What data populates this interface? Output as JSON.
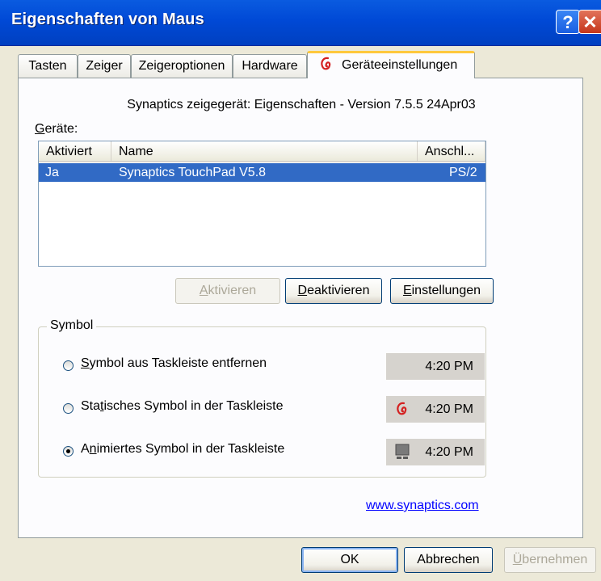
{
  "window": {
    "title": "Eigenschaften von Maus",
    "help_glyph": "?",
    "close_glyph": "✕"
  },
  "tabs": [
    {
      "label": "Tasten"
    },
    {
      "label": "Zeiger"
    },
    {
      "label": "Zeigeroptionen"
    },
    {
      "label": "Hardware"
    },
    {
      "label": "Geräteeinstellungen",
      "active": true
    }
  ],
  "panel": {
    "version_text": "Synaptics zeigegerät: Eigenschaften - Version 7.5.5 24Apr03",
    "devices_label": "Geräte:",
    "columns": [
      "Aktiviert",
      "Name",
      "Anschl..."
    ],
    "rows": [
      {
        "activated": "Ja",
        "name": "Synaptics TouchPad V5.8",
        "port": "PS/2",
        "selected": true
      }
    ],
    "buttons": {
      "activate": "Aktivieren",
      "deactivate": "Deaktivieren",
      "settings": "Einstellungen"
    },
    "symbol_group": {
      "title": "Symbol",
      "options": [
        {
          "label": "Symbol aus Taskleiste entfernen",
          "checked": false,
          "tray_time": "4:20 PM",
          "tray_icon": "none"
        },
        {
          "label": "Statisches Symbol in der Taskleiste",
          "checked": false,
          "tray_time": "4:20 PM",
          "tray_icon": "synaptics-logo-icon"
        },
        {
          "label": "Animiertes Symbol in der Taskleiste",
          "checked": true,
          "tray_time": "4:20 PM",
          "tray_icon": "touchpad-icon"
        }
      ]
    },
    "link": "www.synaptics.com"
  },
  "footer": {
    "ok": "OK",
    "cancel": "Abbrechen",
    "apply": "Übernehmen"
  },
  "colors": {
    "titlebar": "#0a5be0",
    "selection": "#316ac5",
    "active_tab_accent": "#ffc83c",
    "logo_red": "#d42020"
  }
}
